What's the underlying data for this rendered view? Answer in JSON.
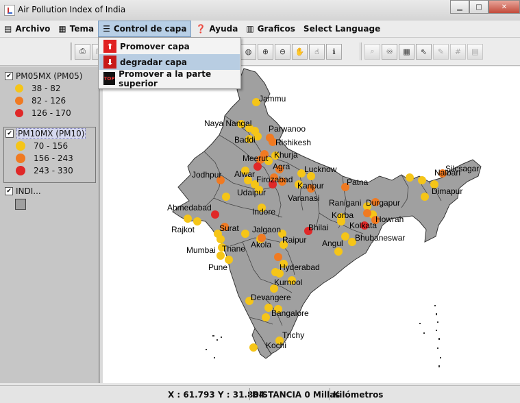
{
  "window": {
    "title": "Air Pollution Index of India"
  },
  "menubar": {
    "items": [
      {
        "label": "Archivo",
        "icon": "folder-icon"
      },
      {
        "label": "Tema",
        "icon": "grid-icon"
      },
      {
        "label": "Control de capa",
        "icon": "layers-icon"
      },
      {
        "label": "Ayuda",
        "icon": "help-icon"
      },
      {
        "label": "Graficos",
        "icon": "chart-icon"
      },
      {
        "label": "Select Language"
      }
    ]
  },
  "layer_menu": {
    "items": [
      {
        "label": "Promover capa",
        "icon": "arrow-up-icon"
      },
      {
        "label": "degradar capa",
        "icon": "arrow-down-icon"
      },
      {
        "label": "Promover a la parte superior",
        "icon": "top-icon",
        "icon_text": "TOP"
      }
    ]
  },
  "legend": {
    "layers": [
      {
        "name": "PM05MX (PM05)",
        "checked": true,
        "classes": [
          {
            "label": "38 - 82",
            "color": "#f5c518"
          },
          {
            "label": "82 - 126",
            "color": "#f07a22"
          },
          {
            "label": "126 - 170",
            "color": "#e02828"
          }
        ]
      },
      {
        "name": "PM10MX (PM10)",
        "checked": true,
        "classes": [
          {
            "label": "70 - 156",
            "color": "#f5c518"
          },
          {
            "label": "156 - 243",
            "color": "#f07a22"
          },
          {
            "label": "243 - 330",
            "color": "#e02828"
          }
        ]
      },
      {
        "name": "INDI...",
        "checked": true,
        "fill": "#a0a0a0"
      }
    ]
  },
  "map": {
    "land_color": "#a0a0a0",
    "cities": [
      "Jammu",
      "Naya Nangal",
      "Parwanoo",
      "Baddi",
      "Rishikesh",
      "Meerut",
      "Khurja",
      "Agra",
      "Lucknow",
      "Firozabad",
      "Alwar",
      "Jodhpur",
      "Kanpur",
      "Patna",
      "Varanasi",
      "Udaipur",
      "Nalbari",
      "Silcsagar",
      "Dimapur",
      "Ranigani",
      "Durgapur",
      "Ahmedabad",
      "Indore",
      "Howrah",
      "Korba",
      "Rajkot",
      "Surat",
      "Bhilai",
      "Kolkata",
      "Jalgaon",
      "Akola",
      "Raipur",
      "Bhubaneswar",
      "Mumbai",
      "Thane",
      "Angul",
      "Pune",
      "Hyderabad",
      "Kurnool",
      "Devangere",
      "Bangalore",
      "Trichy",
      "Kochi"
    ]
  },
  "statusbar": {
    "coords": "X : 61.793 Y : 31.884",
    "distance": "DISTANCIA 0 Millas",
    "units": "Kilómetros"
  }
}
